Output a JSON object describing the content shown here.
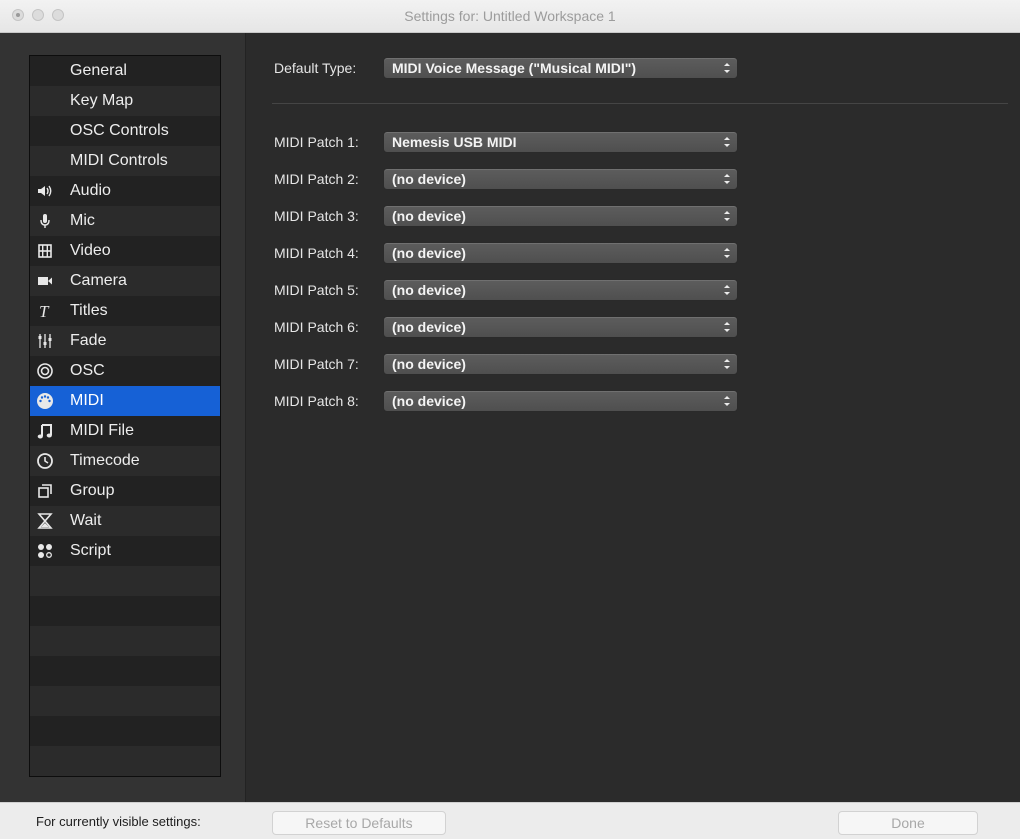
{
  "window": {
    "title": "Settings for: Untitled Workspace 1"
  },
  "sidebar": {
    "selected_index": 11,
    "selected_color": "#1661d6",
    "items": [
      {
        "label": "General",
        "icon": ""
      },
      {
        "label": "Key Map",
        "icon": ""
      },
      {
        "label": "OSC Controls",
        "icon": ""
      },
      {
        "label": "MIDI Controls",
        "icon": ""
      },
      {
        "label": "Audio",
        "icon": "speaker-icon"
      },
      {
        "label": "Mic",
        "icon": "microphone-icon"
      },
      {
        "label": "Video",
        "icon": "film-icon"
      },
      {
        "label": "Camera",
        "icon": "camera-icon"
      },
      {
        "label": "Titles",
        "icon": "text-t-icon"
      },
      {
        "label": "Fade",
        "icon": "faders-icon"
      },
      {
        "label": "OSC",
        "icon": "target-icon"
      },
      {
        "label": "MIDI",
        "icon": "midi-connector-icon"
      },
      {
        "label": "MIDI File",
        "icon": "music-note-icon"
      },
      {
        "label": "Timecode",
        "icon": "clock-icon"
      },
      {
        "label": "Group",
        "icon": "group-icon"
      },
      {
        "label": "Wait",
        "icon": "hourglass-icon"
      },
      {
        "label": "Script",
        "icon": "script-dots-icon"
      },
      {
        "label": "",
        "icon": ""
      },
      {
        "label": "",
        "icon": ""
      },
      {
        "label": "",
        "icon": ""
      },
      {
        "label": "",
        "icon": ""
      },
      {
        "label": "",
        "icon": ""
      },
      {
        "label": "",
        "icon": ""
      },
      {
        "label": "",
        "icon": ""
      }
    ]
  },
  "content": {
    "default_type": {
      "label": "Default Type:",
      "value": "MIDI Voice Message (\"Musical MIDI\")"
    },
    "patches": [
      {
        "label": "MIDI Patch 1:",
        "value": "Nemesis USB MIDI"
      },
      {
        "label": "MIDI Patch 2:",
        "value": "(no device)"
      },
      {
        "label": "MIDI Patch 3:",
        "value": "(no device)"
      },
      {
        "label": "MIDI Patch 4:",
        "value": "(no device)"
      },
      {
        "label": "MIDI Patch 5:",
        "value": "(no device)"
      },
      {
        "label": "MIDI Patch 6:",
        "value": "(no device)"
      },
      {
        "label": "MIDI Patch 7:",
        "value": "(no device)"
      },
      {
        "label": "MIDI Patch 8:",
        "value": "(no device)"
      }
    ]
  },
  "footer": {
    "text": "For currently visible settings:",
    "reset_label": "Reset to Defaults",
    "done_label": "Done"
  }
}
